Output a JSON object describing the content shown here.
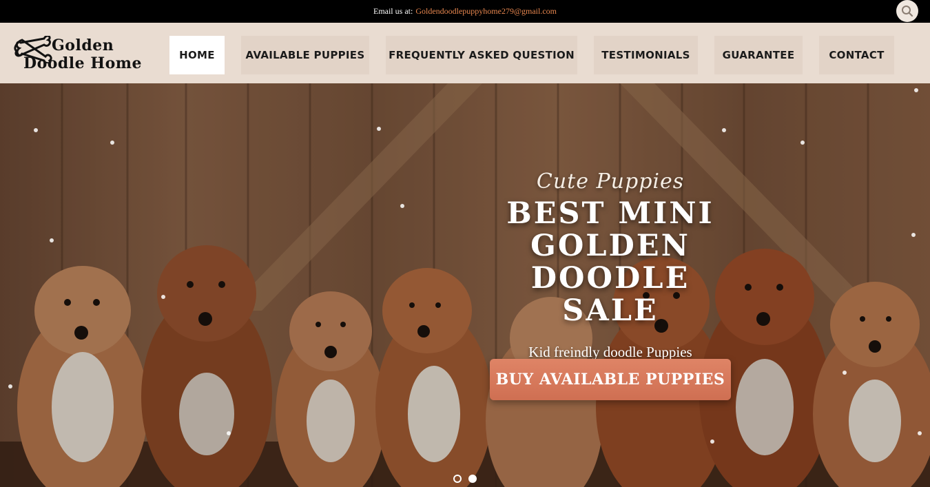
{
  "topbar": {
    "email_label": "Email us at:",
    "email_address": "Goldendoodlepuppyhome279@gmail.com",
    "search_icon": "search-icon"
  },
  "logo": {
    "line1": "Golden",
    "line2": "Doodle Home",
    "icon": "bone-icon"
  },
  "nav": {
    "items": [
      {
        "label": "HOME",
        "active": true
      },
      {
        "label": "AVAILABLE PUPPIES"
      },
      {
        "label": "FREQUENTLY ASKED QUESTION"
      },
      {
        "label": "TESTIMONIALS"
      },
      {
        "label": "GUARANTEE"
      },
      {
        "label": "CONTACT"
      }
    ]
  },
  "hero": {
    "kicker": "Cute Puppies",
    "title": "BEST MINI GOLDEN DOODLE SALE",
    "subtitle": "Kid freindly doodle Puppies",
    "cta": "BUY AVAILABLE PUPPIES",
    "slides": 2,
    "active_slide": 2
  },
  "colors": {
    "accent": "#d67a5c",
    "email_link": "#e8874f",
    "header_bg": "#e9dcd1",
    "nav_item_bg": "#e2d3c7"
  }
}
